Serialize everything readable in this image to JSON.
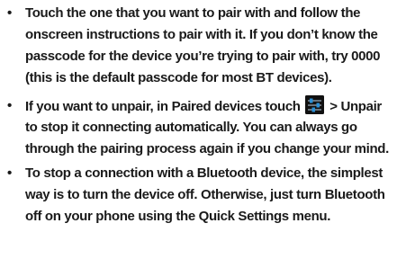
{
  "bullets": [
    {
      "marker": "•",
      "lines": [
        "Touch the one that you want to pair with and follow the",
        "onscreen instructions to pair with it. If you don’t know the",
        "passcode for the device you’re trying to pair with, try 0000",
        "(this is the default passcode for most BT devices)."
      ]
    },
    {
      "marker": "•",
      "line1_before_icon": "If you want to unpair, in Paired devices touch",
      "icon": "settings-sliders-icon",
      "line1_after_icon": "> Unpair",
      "lines": [
        "to stop it connecting automatically. You can always go",
        "through the pairing process again if you change your mind."
      ]
    },
    {
      "marker": "•",
      "lines": [
        "To stop a connection with a Bluetooth device, the simplest",
        "way is to turn the device off. Otherwise, just turn Bluetooth",
        "off on your phone using the Quick Settings menu."
      ]
    }
  ],
  "colors": {
    "text": "#1a1a1a",
    "icon_bg": "#111111",
    "icon_accent": "#2a8fd6"
  }
}
